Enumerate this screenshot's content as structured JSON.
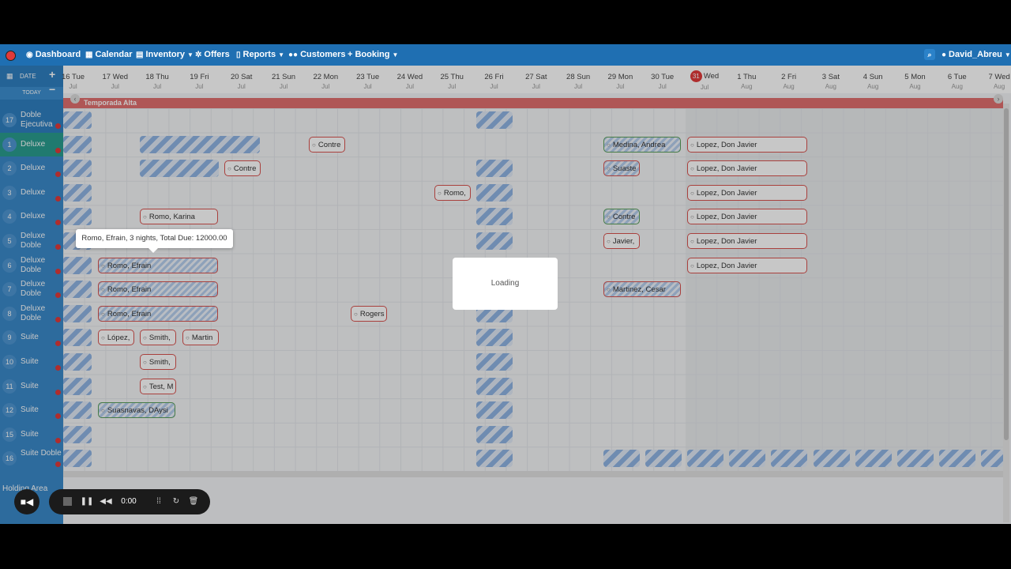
{
  "navbar": {
    "items": [
      {
        "label": "Dashboard",
        "icon": "dashboard-icon"
      },
      {
        "label": "Calendar",
        "icon": "calendar-icon"
      },
      {
        "label": "Inventory",
        "icon": "inventory-icon",
        "dropdown": true
      },
      {
        "label": "Offers",
        "icon": "gear-icon"
      },
      {
        "label": "Reports",
        "icon": "reports-icon",
        "dropdown": true
      },
      {
        "label": "Customers",
        "icon": "users-icon"
      },
      {
        "label": "+ Booking",
        "icon": "",
        "dropdown": true
      }
    ],
    "user": "David_Abreu"
  },
  "sidebar_top": {
    "date_label": "DATE",
    "today_label": "TODAY"
  },
  "dates": [
    {
      "day": "16 Tue",
      "month": "Jul"
    },
    {
      "day": "17 Wed",
      "month": "Jul"
    },
    {
      "day": "18 Thu",
      "month": "Jul"
    },
    {
      "day": "19 Fri",
      "month": "Jul"
    },
    {
      "day": "20 Sat",
      "month": "Jul"
    },
    {
      "day": "21 Sun",
      "month": "Jul"
    },
    {
      "day": "22 Mon",
      "month": "Jul"
    },
    {
      "day": "23 Tue",
      "month": "Jul"
    },
    {
      "day": "24 Wed",
      "month": "Jul"
    },
    {
      "day": "25 Thu",
      "month": "Jul"
    },
    {
      "day": "26 Fri",
      "month": "Jul"
    },
    {
      "day": "27 Sat",
      "month": "Jul"
    },
    {
      "day": "28 Sun",
      "month": "Jul"
    },
    {
      "day": "29 Mon",
      "month": "Jul"
    },
    {
      "day": "30 Tue",
      "month": "Jul"
    },
    {
      "day": "31 Wed",
      "month": "Jul",
      "today": true
    },
    {
      "day": "1 Thu",
      "month": "Aug"
    },
    {
      "day": "2 Fri",
      "month": "Aug"
    },
    {
      "day": "3 Sat",
      "month": "Aug"
    },
    {
      "day": "4 Sun",
      "month": "Aug"
    },
    {
      "day": "5 Mon",
      "month": "Aug"
    },
    {
      "day": "6 Tue",
      "month": "Aug"
    },
    {
      "day": "7 Wed",
      "month": "Aug"
    }
  ],
  "season": "Temporada Alta",
  "rooms": [
    {
      "num": "17",
      "name": "Doble Ejecutiva"
    },
    {
      "num": "1",
      "name": "Deluxe",
      "selected": true
    },
    {
      "num": "2",
      "name": "Deluxe"
    },
    {
      "num": "3",
      "name": "Deluxe"
    },
    {
      "num": "4",
      "name": "Deluxe"
    },
    {
      "num": "5",
      "name": "Deluxe Doble"
    },
    {
      "num": "6",
      "name": "Deluxe Doble"
    },
    {
      "num": "7",
      "name": "Deluxe Doble"
    },
    {
      "num": "8",
      "name": "Deluxe Doble"
    },
    {
      "num": "9",
      "name": "Suite"
    },
    {
      "num": "10",
      "name": "Suite"
    },
    {
      "num": "11",
      "name": "Suite"
    },
    {
      "num": "12",
      "name": "Suite"
    },
    {
      "num": "15",
      "name": "Suite"
    },
    {
      "num": "16",
      "name": "Suite Doble"
    }
  ],
  "bookings": [
    {
      "guest": "Contre",
      "row": 1
    },
    {
      "guest": "Medina, Andrea",
      "row": 1
    },
    {
      "guest": "Lopez, Don Javier",
      "row": 1
    },
    {
      "guest": "Contre",
      "row": 2
    },
    {
      "guest": "Suaste",
      "row": 2
    },
    {
      "guest": "Lopez, Don Javier",
      "row": 2
    },
    {
      "guest": "Romo,",
      "row": 3
    },
    {
      "guest": "Lopez, Don Javier",
      "row": 3
    },
    {
      "guest": "Romo, Karina",
      "row": 4
    },
    {
      "guest": "Contre",
      "row": 4
    },
    {
      "guest": "Lopez, Don Javier",
      "row": 4
    },
    {
      "guest": "Javier,",
      "row": 5
    },
    {
      "guest": "Lopez, Don Javier",
      "row": 5
    },
    {
      "guest": "Romo, Efrain",
      "row": 6
    },
    {
      "guest": "Lopez, Don Javier",
      "row": 6
    },
    {
      "guest": "Romo, Efrain",
      "row": 7
    },
    {
      "guest": "Martinez, Cesar",
      "row": 7
    },
    {
      "guest": "Romo, Efrain",
      "row": 8
    },
    {
      "guest": "Rogers",
      "row": 8
    },
    {
      "guest": "López,",
      "row": 9
    },
    {
      "guest": "Smith,",
      "row": 9
    },
    {
      "guest": "Martin",
      "row": 9
    },
    {
      "guest": "Smith,",
      "row": 10
    },
    {
      "guest": "Test, M",
      "row": 11
    },
    {
      "guest": "Suasnavas, DAysi",
      "row": 12
    }
  ],
  "tooltip": "Romo, Efrain, 3 nights, Total Due: 12000.00",
  "loading": "Loading",
  "holding_area": "Holding Area",
  "recorder": {
    "time": "0:00"
  }
}
